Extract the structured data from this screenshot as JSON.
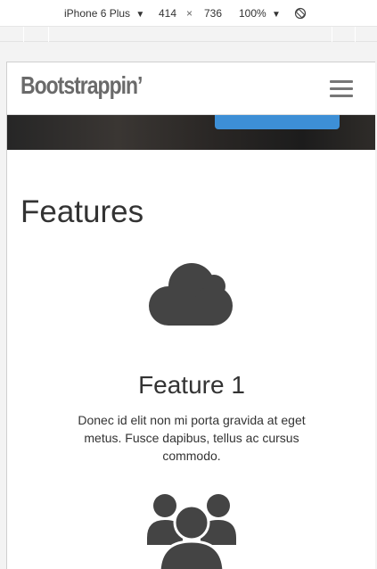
{
  "devtools": {
    "device": "iPhone 6 Plus",
    "width": "414",
    "x_sep": "×",
    "height": "736",
    "zoom": "100%",
    "caret": "▼",
    "rotate_icon": "rotate-icon"
  },
  "navbar": {
    "brand": "Bootstrappin’",
    "toggle_icon": "hamburger-menu-icon"
  },
  "colors": {
    "text": "#333333",
    "brand": "#6a6a6a",
    "hero_button": "#3d8fd6"
  },
  "features": {
    "title": "Features",
    "items": [
      {
        "icon": "cloud-icon",
        "heading": "Feature 1",
        "text": "Donec id elit non mi porta gravida at eget metus. Fusce dapibus, tellus ac cursus commodo."
      },
      {
        "icon": "users-icon"
      }
    ]
  }
}
